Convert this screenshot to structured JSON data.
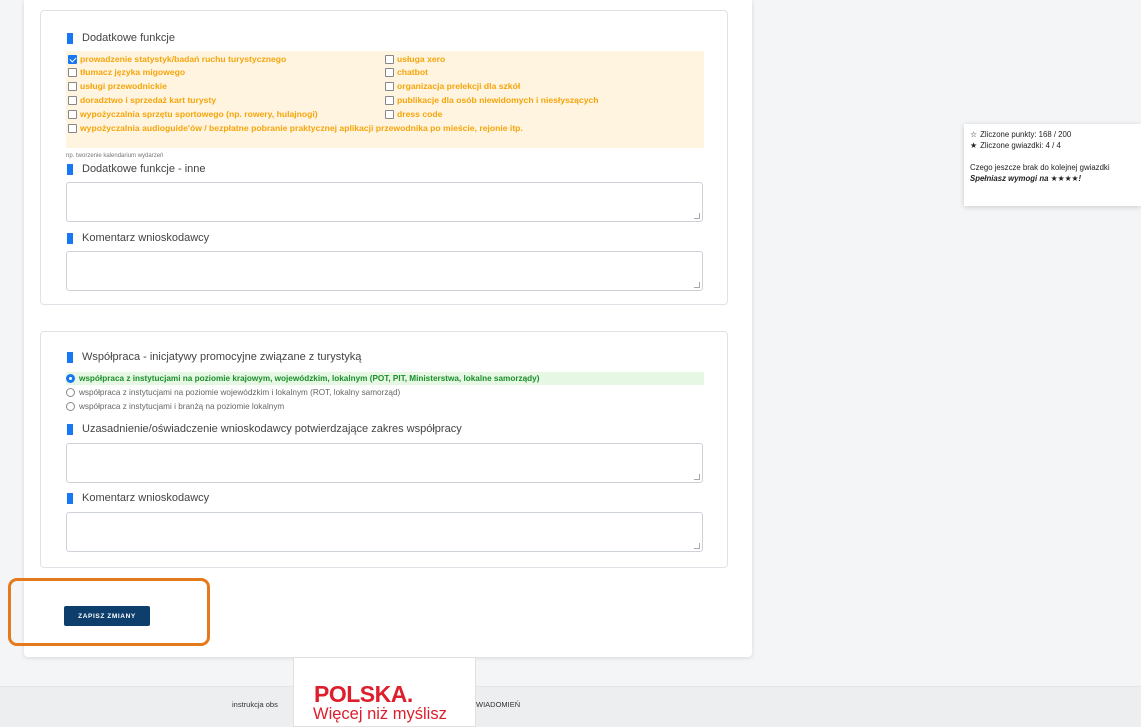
{
  "section_extra": {
    "header": "Dodatkowe funkcje",
    "options": [
      {
        "label": "prowadzenie statystyk/badań ruchu turystycznego",
        "checked": true
      },
      {
        "label": "tłumacz języka migowego",
        "checked": false
      },
      {
        "label": "usługi przewodnickie",
        "checked": false
      },
      {
        "label": "doradztwo i sprzedaż kart turysty",
        "checked": false
      },
      {
        "label": "wypożyczalnia sprzętu sportowego (np. rowery, hulajnogi)",
        "checked": false
      },
      {
        "label": "wypożyczalnia audioguide'ów / bezpłatne pobranie praktycznej aplikacji przewodnika po mieście, rejonie itp.",
        "checked": false
      },
      {
        "label": "usługa xero",
        "checked": false
      },
      {
        "label": "chatbot",
        "checked": false
      },
      {
        "label": "organizacja prelekcji dla szkół",
        "checked": false
      },
      {
        "label": "publikacje dla osób niewidomych i niesłyszących",
        "checked": false
      },
      {
        "label": "dress code",
        "checked": false
      }
    ],
    "hint": "np. tworzenie kalendarium wydarzeń",
    "other_header": "Dodatkowe funkcje - inne",
    "comment_header": "Komentarz wnioskodawcy"
  },
  "section_coop": {
    "header": "Współpraca - inicjatywy promocyjne związane z turystyką",
    "options": [
      {
        "label": "współpraca z instytucjami na poziomie krajowym, wojewódzkim, lokalnym (POT, PIT, Ministerstwa, lokalne samorządy)",
        "selected": true
      },
      {
        "label": "współpraca z instytucjami na poziomie wojewódzkim i lokalnym (ROT, lokalny samorząd)",
        "selected": false
      },
      {
        "label": "współpraca z instytucjami i branżą na poziomie lokalnym",
        "selected": false
      }
    ],
    "justification_header": "Uzasadnienie/oświadczenie wnioskodawcy potwierdzające zakres współpracy",
    "comment_header": "Komentarz wnioskodawcy"
  },
  "save_button": "ZAPISZ ZMIANY",
  "score": {
    "points": "Zliczone punkty: 168 / 200",
    "stars": "Zliczone gwiazdki: 4 / 4",
    "next_star": "Czego jeszcze brak do kolejnej gwiazdki",
    "requirement": "Spełniasz wymogi na ★★★★!"
  },
  "footer": {
    "left_text": "instrukcja obs",
    "right_text": "WIADOMIEŃ"
  },
  "logo": {
    "main": "POLSKA.",
    "sub": "Więcej niż myślisz"
  },
  "colors": {
    "accent": "#1877f2",
    "save_button": "#0e3f6c",
    "highlight_frame": "#e47a1c",
    "option_text": "#f5a50a",
    "option_bg": "#fff4e0",
    "selected_radio_text": "#1a8f2a",
    "selected_radio_bg": "#e6f7e4",
    "logo_red": "#dc1e2d"
  }
}
